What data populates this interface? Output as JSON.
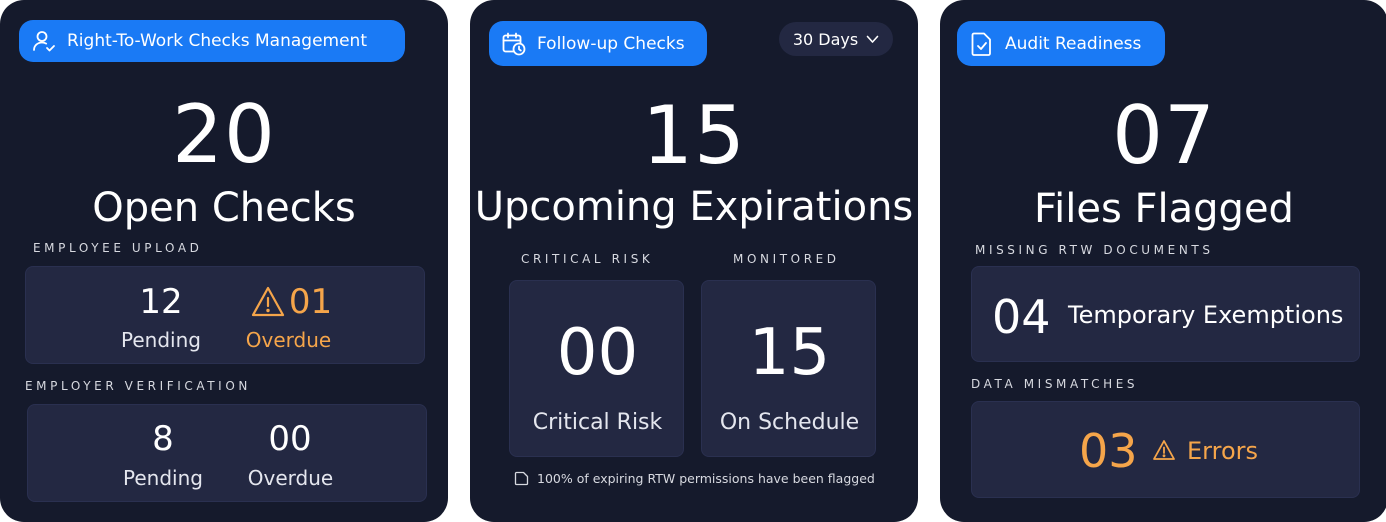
{
  "colors": {
    "card_bg": "#151a2c",
    "box_bg": "#232842",
    "accent": "#1a7af5",
    "warning": "#f5a54a",
    "text": "#ffffff"
  },
  "rtw": {
    "pill_label": "Right-To-Work Checks Management",
    "pill_icon": "user-check-icon",
    "big_value": "20",
    "big_label": "Open Checks",
    "employee_upload": {
      "section_label": "EMPLOYEE UPLOAD",
      "pending_value": "12",
      "pending_label": "Pending",
      "overdue_value": "01",
      "overdue_label": "Overdue",
      "overdue_icon": "warning-triangle-icon"
    },
    "employer_verification": {
      "section_label": "EMPLOYER VERIFICATION",
      "pending_value": "8",
      "pending_label": "Pending",
      "overdue_value": "00",
      "overdue_label": "Overdue"
    }
  },
  "followup": {
    "pill_label": "Follow-up Checks",
    "pill_icon": "calendar-clock-icon",
    "range_selector": {
      "selected": "30 Days",
      "icon": "chevron-down-icon"
    },
    "big_value": "15",
    "big_label": "Upcoming Expirations",
    "critical": {
      "section_label": "CRITICAL RISK",
      "value": "00",
      "label": "Critical Risk"
    },
    "monitored": {
      "section_label": "MONITORED",
      "value": "15",
      "label": "On Schedule"
    },
    "footnote": "100% of expiring RTW permissions have been flagged",
    "footnote_icon": "document-icon"
  },
  "audit": {
    "pill_label": "Audit Readiness",
    "pill_icon": "file-check-icon",
    "big_value": "07",
    "big_label": "Files Flagged",
    "missing_docs": {
      "section_label": "MISSING RTW DOCUMENTS",
      "value": "04",
      "label": "Temporary Exemptions"
    },
    "data_mismatches": {
      "section_label": "DATA MISMATCHES",
      "value": "03",
      "label": "Errors",
      "icon": "warning-triangle-icon"
    }
  }
}
